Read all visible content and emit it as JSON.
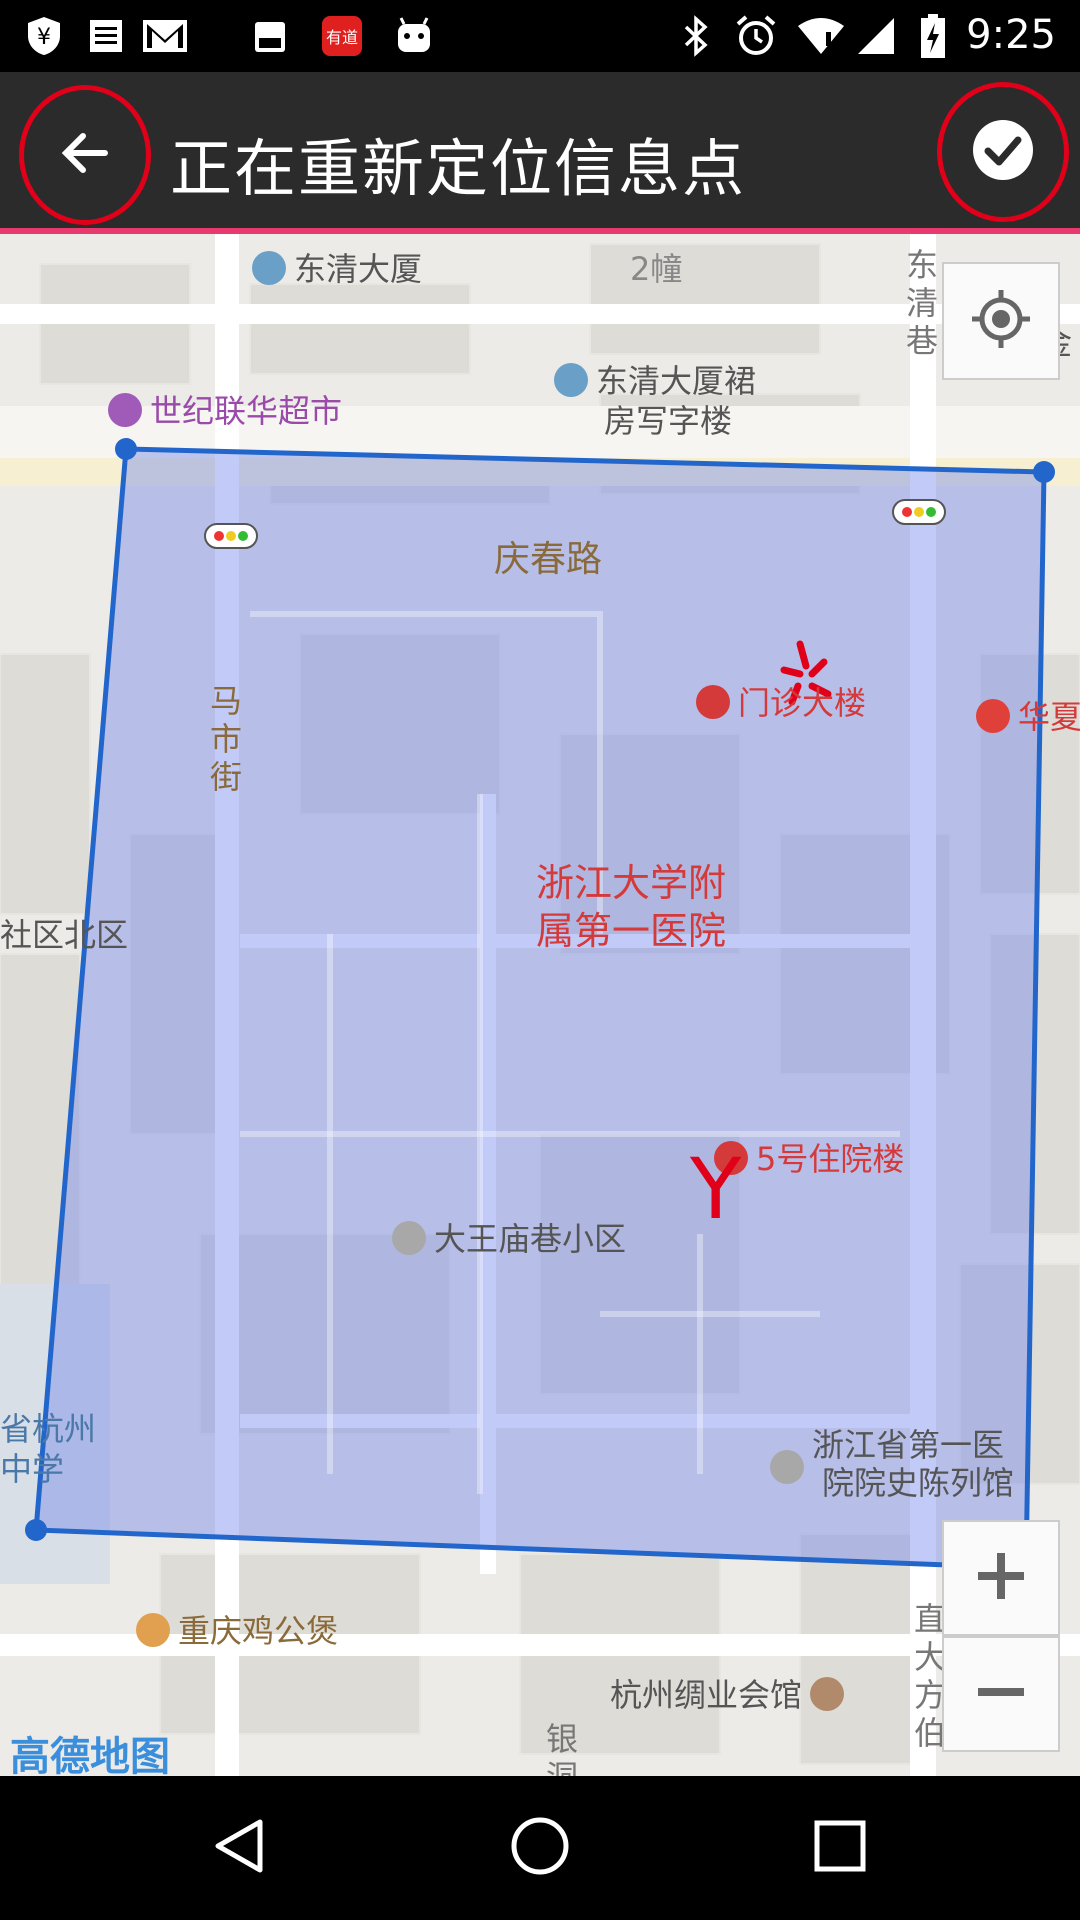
{
  "status_bar": {
    "time": "9:25",
    "left_icons": [
      "currency-icon",
      "document-icon",
      "gmail-icon",
      "shopping-icon",
      "youdao-icon",
      "android-icon"
    ],
    "youdao_label": "有道",
    "right_icons": [
      "bluetooth-icon",
      "alarm-icon",
      "wifi-icon",
      "signal-icon",
      "battery-charging-icon"
    ]
  },
  "app_bar": {
    "title": "正在重新定位信息点",
    "back_icon": "back-arrow-icon",
    "confirm_icon": "check-icon",
    "accent_color": "#e83a6e",
    "annotation_color": "#e0001a"
  },
  "map": {
    "pois": {
      "dongqing_building": "东清大厦",
      "building_2": "2幢",
      "dongqing_annex": "东清大厦裙",
      "dongqing_annex_2": "房写字楼",
      "century_mart": "世纪联华超市",
      "qingchun_road": "庆春路",
      "outpatient": "门诊大楼",
      "huaxia": "华夏",
      "jin": "金",
      "hospital_1": "浙江大学附",
      "hospital_2": "属第一医院",
      "community_north": "社区北区",
      "inpatient_5": "5号住院楼",
      "dawangmiao": "大王庙巷小区",
      "history_museum_1": "浙江省第一医",
      "history_museum_2": "院院史陈列馆",
      "hangzhou_school_1": "省杭州",
      "hangzhou_school_2": "中学",
      "chongqing_chicken": "重庆鸡公煲",
      "silk_guild": "杭州绸业会馆"
    },
    "vertical_labels": {
      "mashi": "马市街",
      "dongqing_lane": "东清巷",
      "zhida": "直大方伯",
      "yindong": "银洞"
    },
    "polygon_color": "#2266cc",
    "fill_color": "rgba(110,130,235,0.42)",
    "watermark": "高德地图",
    "annotation_y": "Y",
    "zoom_in_icon": "plus-icon",
    "zoom_out_icon": "minus-icon",
    "locate_icon": "locate-icon"
  },
  "nav_bar": {
    "back_icon": "nav-back-icon",
    "home_icon": "nav-home-icon",
    "recents_icon": "nav-recents-icon"
  }
}
